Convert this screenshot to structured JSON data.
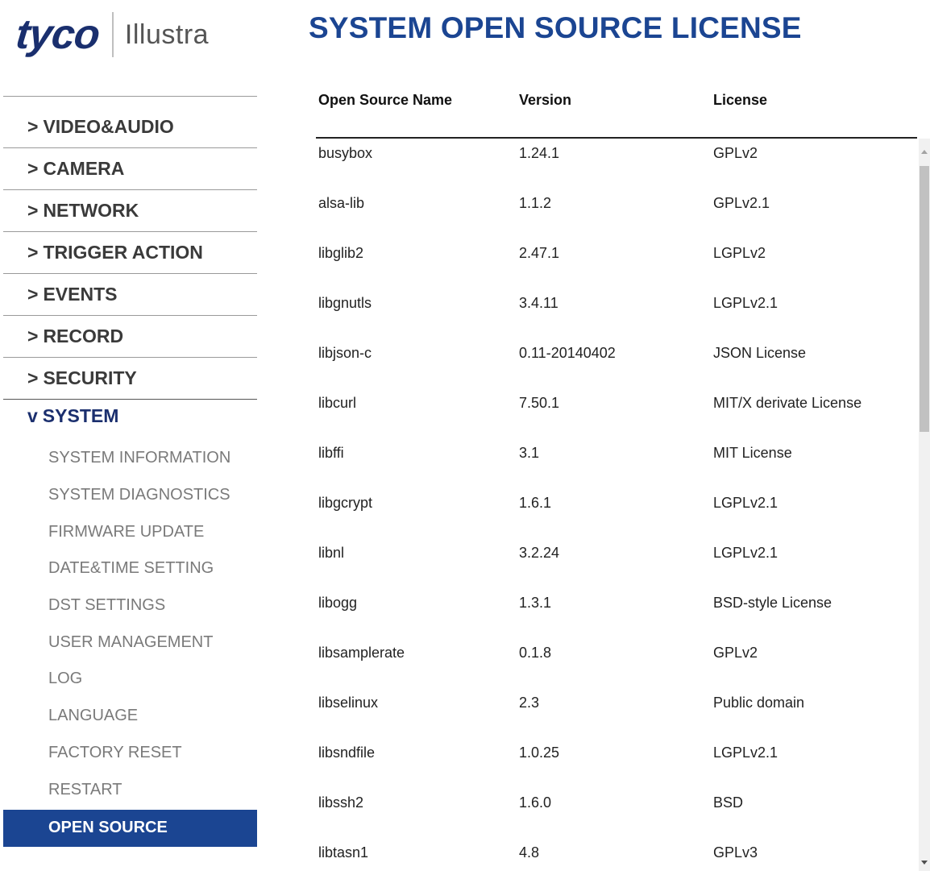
{
  "logo": {
    "brand": "tyco",
    "product": "Illustra"
  },
  "page_title": "SYSTEM OPEN SOURCE LICENSE",
  "nav": {
    "collapsed_caret": ">",
    "expanded_caret": "v",
    "items": [
      {
        "label": "VIDEO&AUDIO"
      },
      {
        "label": "CAMERA"
      },
      {
        "label": "NETWORK"
      },
      {
        "label": "TRIGGER ACTION"
      },
      {
        "label": "EVENTS"
      },
      {
        "label": "RECORD"
      },
      {
        "label": "SECURITY"
      }
    ],
    "active_section": "SYSTEM",
    "sub_items": [
      {
        "label": "SYSTEM INFORMATION"
      },
      {
        "label": "SYSTEM DIAGNOSTICS"
      },
      {
        "label": "FIRMWARE UPDATE"
      },
      {
        "label": "DATE&TIME SETTING"
      },
      {
        "label": "DST SETTINGS"
      },
      {
        "label": "USER MANAGEMENT"
      },
      {
        "label": "LOG"
      },
      {
        "label": "LANGUAGE"
      },
      {
        "label": "FACTORY RESET"
      },
      {
        "label": "RESTART"
      },
      {
        "label": "OPEN SOURCE"
      }
    ]
  },
  "table": {
    "headers": [
      "Open Source Name",
      "Version",
      "License"
    ],
    "rows": [
      [
        "busybox",
        "1.24.1",
        "GPLv2"
      ],
      [
        "alsa-lib",
        "1.1.2",
        "GPLv2.1"
      ],
      [
        "libglib2",
        "2.47.1",
        "LGPLv2"
      ],
      [
        "libgnutls",
        "3.4.11",
        "LGPLv2.1"
      ],
      [
        "libjson-c",
        "0.11-20140402",
        "JSON License"
      ],
      [
        "libcurl",
        "7.50.1",
        "MIT/X derivate License"
      ],
      [
        "libffi",
        "3.1",
        "MIT License"
      ],
      [
        "libgcrypt",
        "1.6.1",
        "LGPLv2.1"
      ],
      [
        "libnl",
        "3.2.24",
        "LGPLv2.1"
      ],
      [
        "libogg",
        "1.3.1",
        "BSD-style License"
      ],
      [
        "libsamplerate",
        "0.1.8",
        "GPLv2"
      ],
      [
        "libselinux",
        "2.3",
        "Public domain"
      ],
      [
        "libsndfile",
        "1.0.25",
        "LGPLv2.1"
      ],
      [
        "libssh2",
        "1.6.0",
        "BSD"
      ],
      [
        "libtasn1",
        "4.8",
        "GPLv3"
      ]
    ]
  },
  "colors": {
    "brand_blue": "#1b4592",
    "logo_navy": "#1a2f6e",
    "selected_bg": "#1b4592"
  }
}
